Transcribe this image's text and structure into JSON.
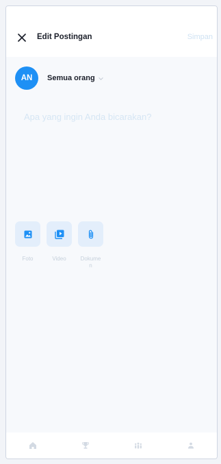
{
  "header": {
    "title": "Edit Postingan",
    "save_label": "Simpan",
    "close_icon": "close-icon"
  },
  "author": {
    "initials": "AN",
    "audience_label": "Semua orang",
    "caret_icon": "chevron-down-icon"
  },
  "composer": {
    "placeholder": "Apa yang ingin Anda bicarakan?"
  },
  "attachments": [
    {
      "label": "Foto",
      "icon": "photo-icon"
    },
    {
      "label": "Video",
      "icon": "video-icon"
    },
    {
      "label": "Dokumen",
      "icon": "paperclip-icon"
    }
  ],
  "bottom_nav": [
    {
      "icon": "home-icon"
    },
    {
      "icon": "trophy-icon"
    },
    {
      "icon": "community-icon"
    },
    {
      "icon": "profile-icon"
    }
  ],
  "colors": {
    "accent": "#1e90f5",
    "muted_accent": "#cfe2f3",
    "tile": "#e3eefb",
    "nav_icon": "#d3dae3"
  }
}
